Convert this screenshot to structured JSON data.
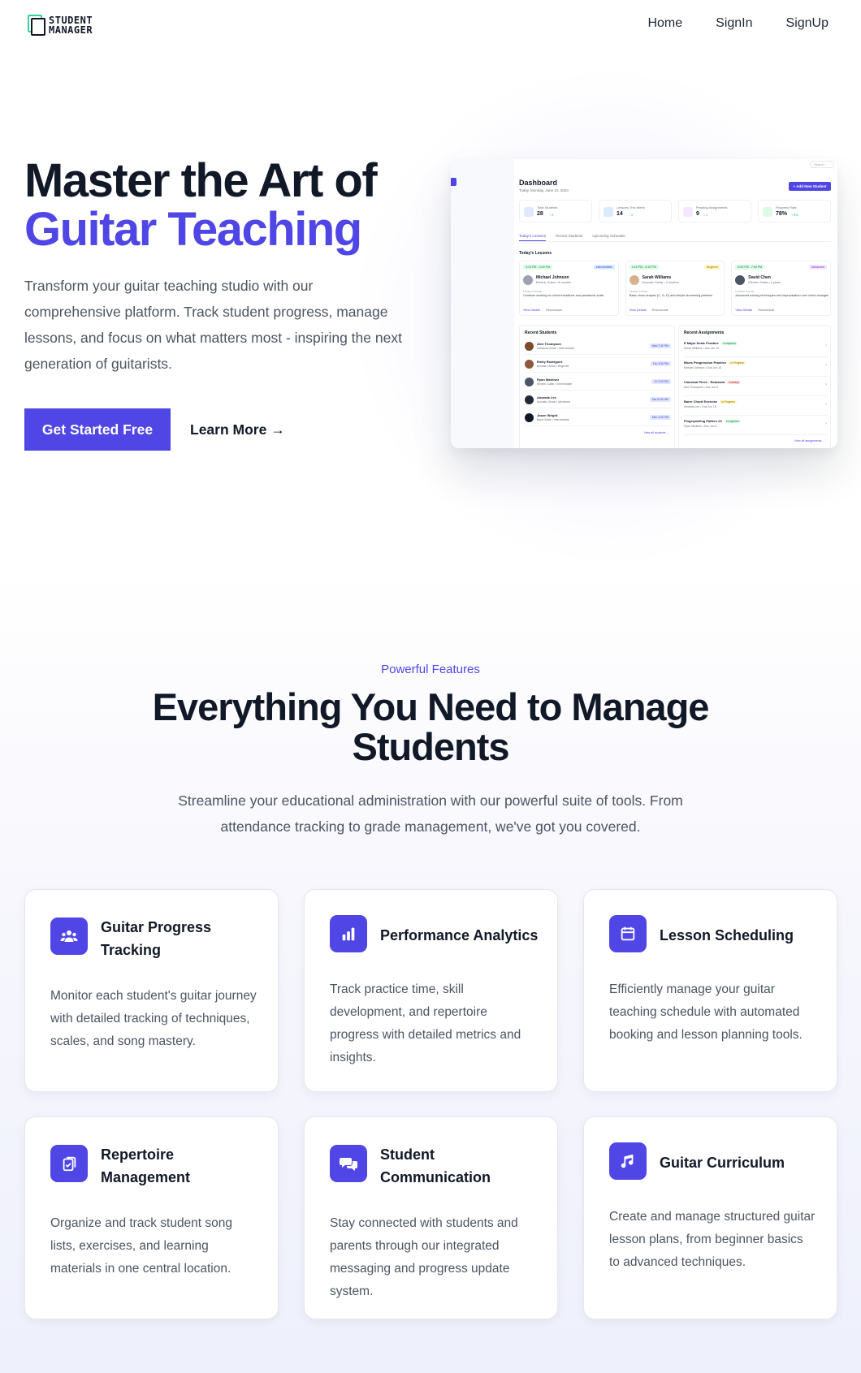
{
  "brand": {
    "line1": "STUDENT",
    "line2": "MANAGER"
  },
  "nav": {
    "items": [
      "Home",
      "SignIn",
      "SignUp"
    ]
  },
  "hero": {
    "title_line1": "Master the Art of",
    "title_line2": "Guitar Teaching",
    "description": "Transform your guitar teaching studio with our comprehensive platform. Track student progress, manage lessons, and focus on what matters most - inspiring the next generation of guitarists.",
    "cta_primary": "Get Started Free",
    "cta_secondary": "Learn More →"
  },
  "dashboard": {
    "search_placeholder": "Search...",
    "title": "Dashboard",
    "subtitle": "Today, Monday, June 10, 2023",
    "add_button": "+ Add New Student",
    "stats": [
      {
        "label": "Total Students",
        "value": "28",
        "change": "↑ 3",
        "icon_color": "#e0e7ff"
      },
      {
        "label": "Lessons This Week",
        "value": "14",
        "change": "↑ 2",
        "icon_color": "#dbeafe"
      },
      {
        "label": "Pending Assignments",
        "value": "9",
        "change": "↓ 1",
        "icon_color": "#f3e8ff"
      },
      {
        "label": "Progress Rate",
        "value": "78%",
        "change": "↑ 5%",
        "icon_color": "#dcfce7"
      }
    ],
    "tabs": [
      "Today's Lessons",
      "Recent Students",
      "Upcoming Schedule"
    ],
    "lessons_heading": "Today's Lessons",
    "lessons": [
      {
        "time": "3:15 PM - 4:00 PM",
        "level": "Intermediate",
        "level_bg": "#dbeafe",
        "level_color": "#1d4ed8",
        "name": "Michael Johnson",
        "instrument": "Electric Guitar • 8 months",
        "focus_label": "Lesson Focus:",
        "focus": "Continue working on chord transitions and pentatonic scale",
        "view": "View Details",
        "reschedule": "Reschedule"
      },
      {
        "time": "4:15 PM - 5:15 PM",
        "level": "Beginner",
        "level_bg": "#fef9c3",
        "level_color": "#a16207",
        "name": "Sarah Williams",
        "instrument": "Acoustic Guitar • 2 months",
        "focus_label": "Lesson Focus:",
        "focus": "Basic chord shapes (C, G, D) and simple strumming patterns",
        "view": "View Details",
        "reschedule": "Reschedule"
      },
      {
        "time": "6:00 PM - 7:00 PM",
        "level": "Advanced",
        "level_bg": "#f3e8ff",
        "level_color": "#7e22ce",
        "name": "David Chen",
        "instrument": "Electric Guitar • 2 years",
        "focus_label": "Lesson Focus:",
        "focus": "Advanced soloing techniques and improvisation over chord changes",
        "view": "View Details",
        "reschedule": "Reschedule"
      }
    ],
    "recent_students_heading": "Recent Students",
    "recent_students": [
      {
        "name": "Alex Thompson",
        "info": "Classical Guitar • Intermediate",
        "date": "Wed 2:30 PM"
      },
      {
        "name": "Emily Rodriguez",
        "info": "Acoustic Guitar • Beginner",
        "date": "Thu 3:30 PM"
      },
      {
        "name": "Ryan Martinez",
        "info": "Electric Guitar • Intermediate",
        "date": "Fri 2:00 PM"
      },
      {
        "name": "Amanda Lee",
        "info": "Acoustic Guitar • Advanced",
        "date": "Sat 10:00 AM"
      },
      {
        "name": "Jason Wright",
        "info": "Bass Guitar • Intermediate",
        "date": "Mon 4:00 PM"
      }
    ],
    "view_all_students": "View all students →",
    "recent_assignments_heading": "Recent Assignments",
    "recent_assignments": [
      {
        "title": "E Major Scale Practice",
        "badge": "Completed",
        "badge_bg": "#dcfce7",
        "badge_color": "#15803d",
        "info": "Sarah Williams • Due Jun 12"
      },
      {
        "title": "Blues Progression Practice",
        "badge": "In Progress",
        "badge_bg": "#fef9c3",
        "badge_color": "#a16207",
        "info": "Michael Johnson • Due Jun 15"
      },
      {
        "title": "Classical Piece - Romanza",
        "badge": "Overdue",
        "badge_bg": "#fee2e2",
        "badge_color": "#b91c1c",
        "info": "Alex Thompson • Due Jun 5"
      },
      {
        "title": "Barre Chord Exercise",
        "badge": "In Progress",
        "badge_bg": "#fef9c3",
        "badge_color": "#a16207",
        "info": "Amanda Lee • Due Jun 18"
      },
      {
        "title": "Fingerpicking Pattern #3",
        "badge": "Completed",
        "badge_bg": "#dcfce7",
        "badge_color": "#15803d",
        "info": "Ryan Martinez • Due Jun 8"
      }
    ],
    "view_all_assignments": "View all assignments →"
  },
  "features": {
    "eyebrow": "Powerful Features",
    "title": "Everything You Need to Manage Students",
    "description": "Streamline your educational administration with our powerful suite of tools. From attendance tracking to grade management, we've got you covered.",
    "cards": [
      {
        "icon": "users-icon",
        "title": "Guitar Progress Tracking",
        "text": "Monitor each student's guitar journey with detailed tracking of techniques, scales, and song mastery."
      },
      {
        "icon": "bar-chart-icon",
        "title": "Performance Analytics",
        "text": "Track practice time, skill development, and repertoire progress with detailed metrics and insights."
      },
      {
        "icon": "calendar-icon",
        "title": "Lesson Scheduling",
        "text": "Efficiently manage your guitar teaching schedule with automated booking and lesson planning tools."
      },
      {
        "icon": "clipboard-check-icon",
        "title": "Repertoire Management",
        "text": "Organize and track student song lists, exercises, and learning materials in one central location."
      },
      {
        "icon": "chat-bubbles-icon",
        "title": "Student Communication",
        "text": "Stay connected with students and parents through our integrated messaging and progress update system."
      },
      {
        "icon": "music-note-icon",
        "title": "Guitar Curriculum",
        "text": "Create and manage structured guitar lesson plans, from beginner basics to advanced techniques."
      }
    ]
  },
  "colors": {
    "accent": "#4f46e5",
    "text": "#111827",
    "muted": "#4b5563"
  }
}
